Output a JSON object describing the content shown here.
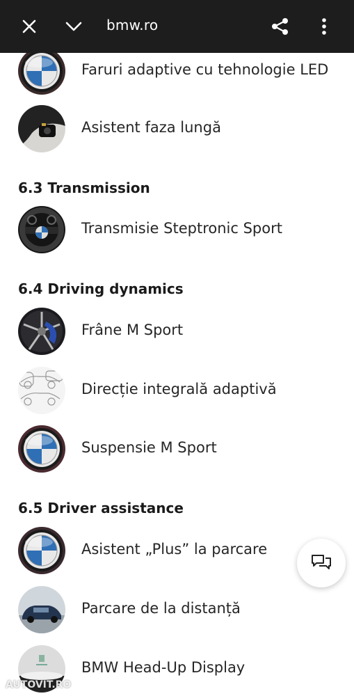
{
  "browser": {
    "url": "bmw.ro",
    "icons": [
      "close-icon",
      "chevron-down-icon",
      "share-icon",
      "more-vert-icon"
    ]
  },
  "sections": [
    {
      "items": [
        {
          "label": "Faruri adaptive cu tehnologie LED",
          "thumb": "bmw-logo"
        },
        {
          "label": "Asistent faza lungă",
          "thumb": "camera"
        }
      ]
    },
    {
      "title": "6.3 Transmission",
      "items": [
        {
          "label": "Transmisie Steptronic Sport",
          "thumb": "steering-wheel"
        }
      ]
    },
    {
      "title": "6.4 Driving dynamics",
      "items": [
        {
          "label": "Frâne M Sport",
          "thumb": "brake"
        },
        {
          "label": "Direcție integrală adaptivă",
          "thumb": "car-sketch"
        },
        {
          "label": "Suspensie M Sport",
          "thumb": "bmw-logo"
        }
      ]
    },
    {
      "title": "6.5 Driver assistance",
      "items": [
        {
          "label": "Asistent „Plus” la parcare",
          "thumb": "bmw-logo"
        },
        {
          "label": "Parcare de la distanță",
          "thumb": "car-photo"
        },
        {
          "label": "BMW Head-Up Display",
          "thumb": "hud"
        }
      ]
    }
  ],
  "chat_button": {
    "icon": "chat-icon"
  },
  "watermark": "AUTOVIT.RO",
  "colors": {
    "topbar": "#1d1d1d",
    "bmw_blue": "#2f6fb5",
    "text": "#262626"
  }
}
